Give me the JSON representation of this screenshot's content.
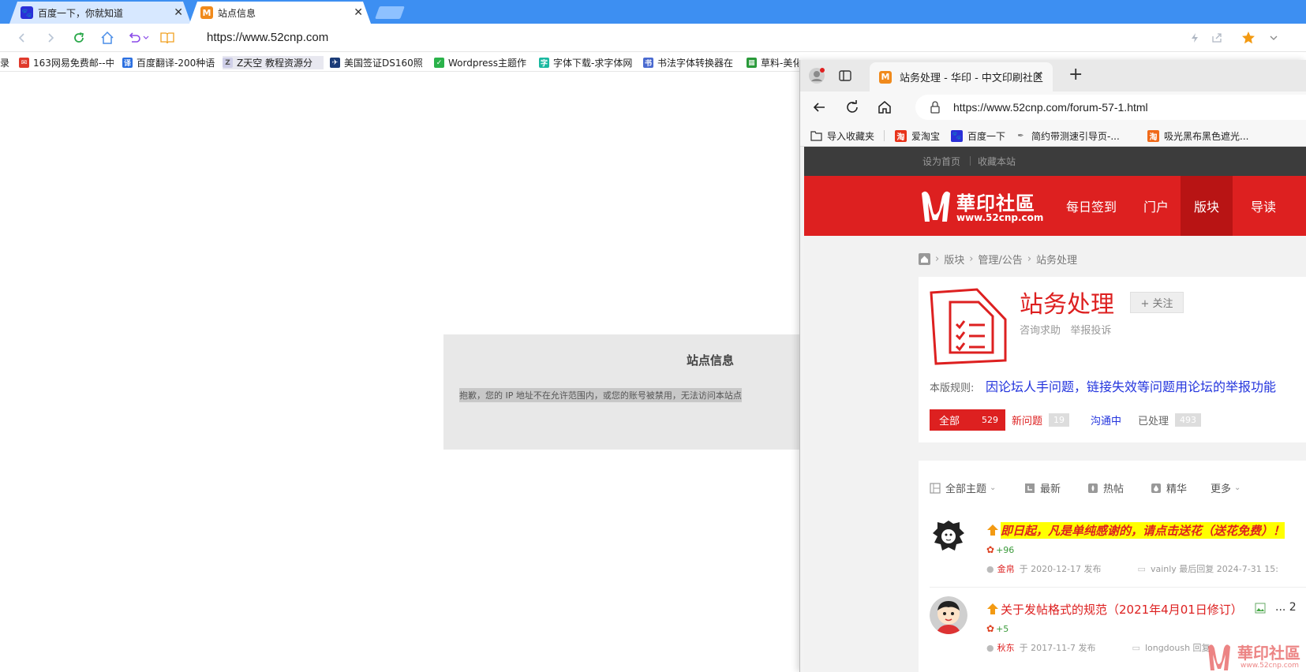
{
  "browser1": {
    "tabs": [
      {
        "label": "百度一下，你就知道"
      },
      {
        "label": "站点信息"
      }
    ],
    "url": "https://www.52cnp.com",
    "bookmarks": [
      {
        "label": "163网易免费邮--中"
      },
      {
        "label": "百度翻译-200种语"
      },
      {
        "label": "Z天空 教程资源分"
      },
      {
        "label": "美国签证DS160照"
      },
      {
        "label": "Wordpress主题作"
      },
      {
        "label": "字体下载-求字体网"
      },
      {
        "label": "书法字体转换器在"
      },
      {
        "label": "草料-美化"
      }
    ],
    "notice": {
      "title": "站点信息",
      "message": "抱歉，您的 IP 地址不在允许范围内，或您的账号被禁用，无法访问本站点"
    }
  },
  "browser2": {
    "tab_title": "站务处理 - 华印 - 中文印刷社区",
    "url": "https://www.52cnp.com/forum-57-1.html",
    "favorites": [
      {
        "label": "导入收藏夹"
      },
      {
        "label": "爱淘宝"
      },
      {
        "label": "百度一下"
      },
      {
        "label": "简约带测速引导页-..."
      },
      {
        "label": "吸光黑布黑色遮光..."
      }
    ],
    "site": {
      "top_links": [
        "设为首页",
        "收藏本站"
      ],
      "logo_text": "華印社區",
      "logo_url": "www.52cnp.com",
      "nav": [
        "每日签到",
        "门户",
        "版块",
        "导读"
      ],
      "breadcrumb": [
        "版块",
        "管理/公告",
        "站务处理"
      ],
      "forum": {
        "name": "站务处理",
        "follow": "+ 关注",
        "tags": "咨询求助   举报投诉",
        "rules_label": "本版规则:",
        "rules_text": "因论坛人手问题，链接失效等问题用论坛的举报功能",
        "filters": [
          {
            "label": "全部",
            "count": "529"
          },
          {
            "label": "新问题",
            "count": "19"
          },
          {
            "label": "沟通中",
            "count": ""
          },
          {
            "label": "已处理",
            "count": "493"
          }
        ]
      },
      "list_filters": [
        "全部主题",
        "最新",
        "热帖",
        "精华",
        "更多"
      ],
      "threads": [
        {
          "title": "即日起，凡是单纯感谢的，请点击送花（送花免费）！",
          "flowers": "+96",
          "author": "金帛",
          "posted": "于 2020-12-17 发布",
          "last_reply": "vainly 最后回复 2024-7-31 15:"
        },
        {
          "title": "关于发帖格式的规范（2021年4月01日修订）",
          "suffix": "... 2",
          "flowers": "+5",
          "author": "秋东",
          "posted": "于 2017-11-7 发布",
          "last_reply": "longdoush 回复"
        }
      ]
    }
  },
  "watermark": {
    "text": "華印社區",
    "url": "www.52cnp.com"
  },
  "colors": {
    "tabstrip": "#3d8ff2",
    "site_red": "#dd2020",
    "link_blue": "#2233dd"
  }
}
